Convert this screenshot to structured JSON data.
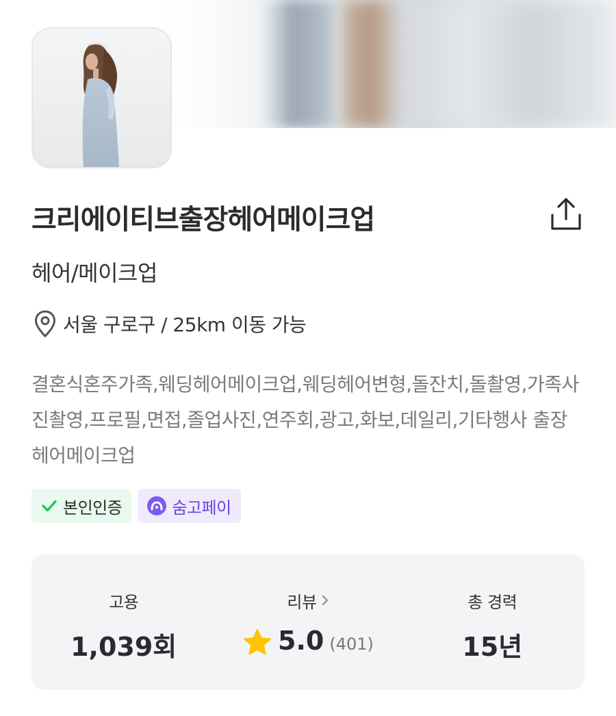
{
  "profile": {
    "name": "크리에이티브출장헤어메이크업",
    "category": "헤어/메이크업",
    "location": "서울 구로구 / 25km 이동 가능",
    "description": "결혼식혼주가족,웨딩헤어메이크업,웨딩헤어변형,돌잔치,돌촬영,가족사진촬영,프로필,면접,졸업사진,연주회,광고,화보,데일리,기타행사 출장 헤어메이크업"
  },
  "badges": {
    "verified": "본인인증",
    "pay": "숨고페이"
  },
  "stats": {
    "hires_label": "고용",
    "hires_value": "1,039회",
    "review_label": "리뷰",
    "rating": "5.0",
    "review_count": "(401)",
    "career_label": "총 경력",
    "career_value": "15년"
  },
  "icons": {
    "share": "share-icon",
    "location": "location-pin-icon",
    "check": "check-icon",
    "pay": "soomgo-pay-icon",
    "chevron": "chevron-right-icon",
    "star": "star-icon"
  },
  "colors": {
    "verify_bg": "#e9f9ef",
    "verify_check": "#22c55e",
    "pay_bg": "#efebfd",
    "pay_text": "#6a44d8",
    "star": "#ffc300",
    "stats_bg": "#f3f4f6"
  }
}
